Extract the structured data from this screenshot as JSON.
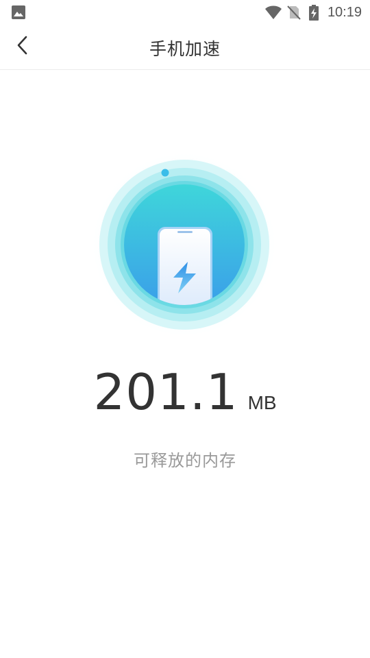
{
  "status_bar": {
    "time": "10:19",
    "icons": [
      "image-notification-icon",
      "wifi-icon",
      "no-sim-icon",
      "battery-charging-icon"
    ]
  },
  "header": {
    "title": "手机加速",
    "back_icon": "back-arrow-icon"
  },
  "memory": {
    "value": "201.1",
    "unit": "MB",
    "caption": "可释放的内存"
  },
  "illustration": {
    "icon": "phone-lightning-icon"
  },
  "colors": {
    "accent_cyan": "#3fd3dd",
    "accent_blue": "#3aa3ea",
    "text_primary": "#333333",
    "text_secondary": "#999999"
  }
}
